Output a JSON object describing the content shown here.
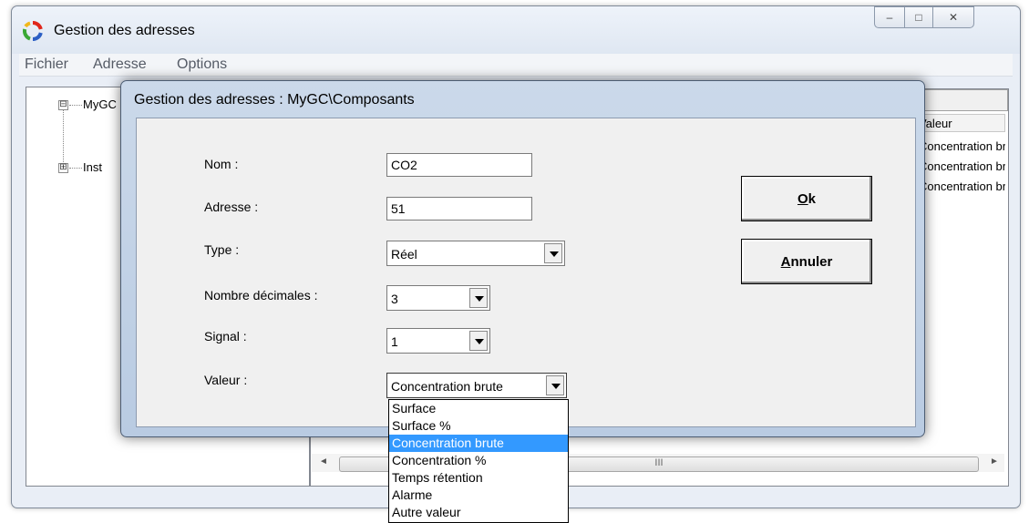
{
  "window": {
    "title": "Gestion des adresses"
  },
  "titlebar_buttons": {
    "minimize": "–",
    "maximize": "□",
    "close": "✕"
  },
  "menu": [
    "Fichier",
    "Adresse",
    "Options"
  ],
  "tree": {
    "nodes": [
      {
        "label": "MyGC",
        "expander": "⊟"
      },
      {
        "label": "Inst",
        "expander": "⊞"
      }
    ]
  },
  "list": {
    "column_header": "Valeur",
    "rows": [
      "Concentration brute",
      "Concentration brute",
      "Concentration brute"
    ],
    "scroll_thumb_glyph": "III",
    "scroll_left": "◄",
    "scroll_right": "►"
  },
  "dialog": {
    "title": "Gestion des adresses : MyGC\\Composants",
    "fields": {
      "nom": {
        "label": "Nom :",
        "value": "CO2"
      },
      "adresse": {
        "label": "Adresse :",
        "value": "51"
      },
      "type": {
        "label": "Type :",
        "value": "Réel"
      },
      "decimales": {
        "label": "Nombre décimales :",
        "value": "3"
      },
      "signal": {
        "label": "Signal :",
        "value": "1"
      },
      "valeur": {
        "label": "Valeur :",
        "value": "Concentration brute"
      }
    },
    "ok": {
      "mnemonic": "O",
      "rest": "k"
    },
    "annuler": {
      "mnemonic": "A",
      "rest": "nnuler"
    }
  },
  "valeur_dropdown": {
    "options": [
      "Surface",
      "Surface %",
      "Concentration brute",
      "Concentration %",
      "Temps rétention",
      "Alarme",
      "Autre valeur"
    ],
    "selected": "Concentration brute"
  },
  "colors": {
    "selection": "#3399ff",
    "dialog_frame": "#c3d3e8"
  }
}
